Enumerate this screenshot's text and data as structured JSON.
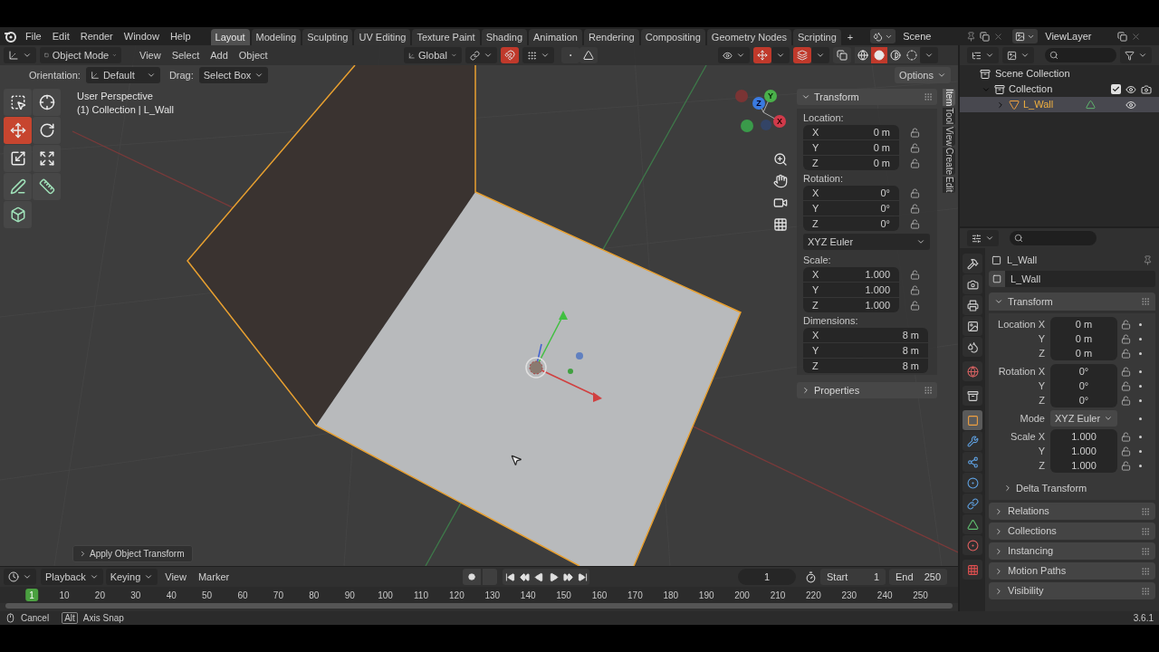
{
  "top_bar": {
    "menus": [
      "File",
      "Edit",
      "Render",
      "Window",
      "Help"
    ],
    "workspaces": [
      {
        "label": "Layout",
        "selected": true
      },
      {
        "label": "Modeling",
        "selected": false
      },
      {
        "label": "Sculpting",
        "selected": false
      },
      {
        "label": "UV Editing",
        "selected": false
      },
      {
        "label": "Texture Paint",
        "selected": false
      },
      {
        "label": "Shading",
        "selected": false
      },
      {
        "label": "Animation",
        "selected": false
      },
      {
        "label": "Rendering",
        "selected": false
      },
      {
        "label": "Compositing",
        "selected": false
      },
      {
        "label": "Geometry Nodes",
        "selected": false
      },
      {
        "label": "Scripting",
        "selected": false
      }
    ],
    "add_tab": "+",
    "scene": "Scene",
    "view_layer": "ViewLayer"
  },
  "viewport": {
    "header": {
      "mode": "Object Mode",
      "menus": [
        "View",
        "Select",
        "Add",
        "Object"
      ],
      "orientation": "Global",
      "snap": true,
      "show_gizmos": true,
      "show_overlays": true,
      "shading": [
        {
          "kind": "wireframe",
          "selected": false
        },
        {
          "kind": "solid",
          "selected": true
        },
        {
          "kind": "material",
          "selected": false
        },
        {
          "kind": "rendered",
          "selected": false
        }
      ]
    },
    "tool_settings": {
      "orientation_label": "Orientation:",
      "orientation": "Default",
      "drag_label": "Drag:",
      "drag": "Select Box",
      "options": "Options"
    },
    "info": [
      "User Perspective",
      "(1) Collection | L_Wall"
    ],
    "tools": [
      {
        "kind": "select_box",
        "selected": false
      },
      {
        "kind": "cursor",
        "selected": false
      },
      {
        "kind": "move",
        "selected": true
      },
      {
        "kind": "rotate",
        "selected": false
      },
      {
        "kind": "scale",
        "selected": false
      },
      {
        "kind": "transform",
        "selected": false
      },
      {
        "kind": "annotate",
        "selected": false
      },
      {
        "kind": "measure",
        "selected": false
      },
      {
        "kind": "add_cube",
        "selected": false
      }
    ],
    "axes": [
      "X",
      "Y",
      "Z"
    ],
    "last_operator": "Apply Object Transform",
    "sidebar": {
      "tabs": [
        {
          "label": "Item",
          "selected": true
        },
        {
          "label": "Tool",
          "selected": false
        },
        {
          "label": "View",
          "selected": false
        },
        {
          "label": "Create",
          "selected": false
        },
        {
          "label": "Edit",
          "selected": false
        }
      ],
      "panel": "Transform",
      "groups": [
        {
          "label": "Location:",
          "kind": "fields",
          "locks": true,
          "rows": [
            {
              "label": "X",
              "value": "0 m"
            },
            {
              "label": "Y",
              "value": "0 m"
            },
            {
              "label": "Z",
              "value": "0 m"
            }
          ]
        },
        {
          "label": "Rotation:",
          "kind": "fields",
          "locks": true,
          "rows": [
            {
              "label": "X",
              "value": "0°"
            },
            {
              "label": "Y",
              "value": "0°"
            },
            {
              "label": "Z",
              "value": "0°"
            }
          ]
        },
        {
          "kind": "dropdown",
          "value": "XYZ Euler"
        },
        {
          "label": "Scale:",
          "kind": "fields",
          "locks": true,
          "rows": [
            {
              "label": "X",
              "value": "1.000"
            },
            {
              "label": "Y",
              "value": "1.000"
            },
            {
              "label": "Z",
              "value": "1.000"
            }
          ]
        },
        {
          "label": "Dimensions:",
          "kind": "fields",
          "locks": false,
          "rows": [
            {
              "label": "X",
              "value": "8 m"
            },
            {
              "label": "Y",
              "value": "8 m"
            },
            {
              "label": "Z",
              "value": "8 m"
            }
          ]
        }
      ],
      "collapsed_panels": [
        "Properties"
      ]
    }
  },
  "outliner": {
    "root": "Scene Collection",
    "children": [
      {
        "name": "Collection",
        "kind": "collection",
        "expanded": true,
        "included": true,
        "selected": false,
        "children": [
          {
            "name": "L_Wall",
            "kind": "object",
            "expanded": false,
            "selected": true
          }
        ]
      }
    ]
  },
  "properties": {
    "tabs": [
      {
        "kind": "tool",
        "selected": false
      },
      {
        "kind": "render",
        "selected": false
      },
      {
        "kind": "output",
        "selected": false
      },
      {
        "kind": "view_layer",
        "selected": false
      },
      {
        "kind": "scene",
        "selected": false
      },
      {
        "kind": "world",
        "selected": false
      },
      {
        "kind": "collection",
        "selected": false
      },
      {
        "kind": "object",
        "selected": true
      },
      {
        "kind": "modifiers",
        "selected": false
      },
      {
        "kind": "particles",
        "selected": false
      },
      {
        "kind": "physics",
        "selected": false
      },
      {
        "kind": "constraints",
        "selected": false
      },
      {
        "kind": "data",
        "selected": false
      },
      {
        "kind": "material",
        "selected": false
      },
      {
        "kind": "texture",
        "selected": false
      }
    ],
    "object_name": "L_Wall",
    "datablock": "L_Wall",
    "panel": "Transform",
    "groups": [
      {
        "kind": "fields",
        "rows": [
          {
            "label": "Location X",
            "value": "0 m"
          },
          {
            "label": "Y",
            "value": "0 m"
          },
          {
            "label": "Z",
            "value": "0 m"
          }
        ]
      },
      {
        "kind": "fields",
        "rows": [
          {
            "label": "Rotation X",
            "value": "0°"
          },
          {
            "label": "Y",
            "value": "0°"
          },
          {
            "label": "Z",
            "value": "0°"
          }
        ]
      },
      {
        "kind": "dropdown",
        "rows": [
          {
            "label": "Mode",
            "value": "XYZ Euler"
          }
        ]
      },
      {
        "kind": "fields",
        "rows": [
          {
            "label": "Scale X",
            "value": "1.000"
          },
          {
            "label": "Y",
            "value": "1.000"
          },
          {
            "label": "Z",
            "value": "1.000"
          }
        ]
      }
    ],
    "subpanel": "Delta Transform",
    "panels": [
      "Relations",
      "Collections",
      "Instancing",
      "Motion Paths",
      "Visibility"
    ]
  },
  "timeline": {
    "menus": [
      "Playback",
      "Keying",
      "View",
      "Marker"
    ],
    "current_frame": "1",
    "start_label": "Start",
    "start": "1",
    "end_label": "End",
    "end": "250",
    "ruler": [
      {
        "label": "1",
        "current": true
      },
      {
        "label": "10",
        "current": false
      },
      {
        "label": "20",
        "current": false
      },
      {
        "label": "30",
        "current": false
      },
      {
        "label": "40",
        "current": false
      },
      {
        "label": "50",
        "current": false
      },
      {
        "label": "60",
        "current": false
      },
      {
        "label": "70",
        "current": false
      },
      {
        "label": "80",
        "current": false
      },
      {
        "label": "90",
        "current": false
      },
      {
        "label": "100",
        "current": false
      },
      {
        "label": "110",
        "current": false
      },
      {
        "label": "120",
        "current": false
      },
      {
        "label": "130",
        "current": false
      },
      {
        "label": "140",
        "current": false
      },
      {
        "label": "150",
        "current": false
      },
      {
        "label": "160",
        "current": false
      },
      {
        "label": "170",
        "current": false
      },
      {
        "label": "180",
        "current": false
      },
      {
        "label": "190",
        "current": false
      },
      {
        "label": "200",
        "current": false
      },
      {
        "label": "210",
        "current": false
      },
      {
        "label": "220",
        "current": false
      },
      {
        "label": "230",
        "current": false
      },
      {
        "label": "240",
        "current": false
      },
      {
        "label": "250",
        "current": false
      }
    ]
  },
  "status_bar": {
    "hints": [
      {
        "kind": "mouse",
        "text": "Cancel"
      },
      {
        "kind": "key",
        "text": "Alt"
      },
      {
        "kind": "label",
        "text": "Axis Snap"
      }
    ],
    "version": "3.6.1"
  }
}
